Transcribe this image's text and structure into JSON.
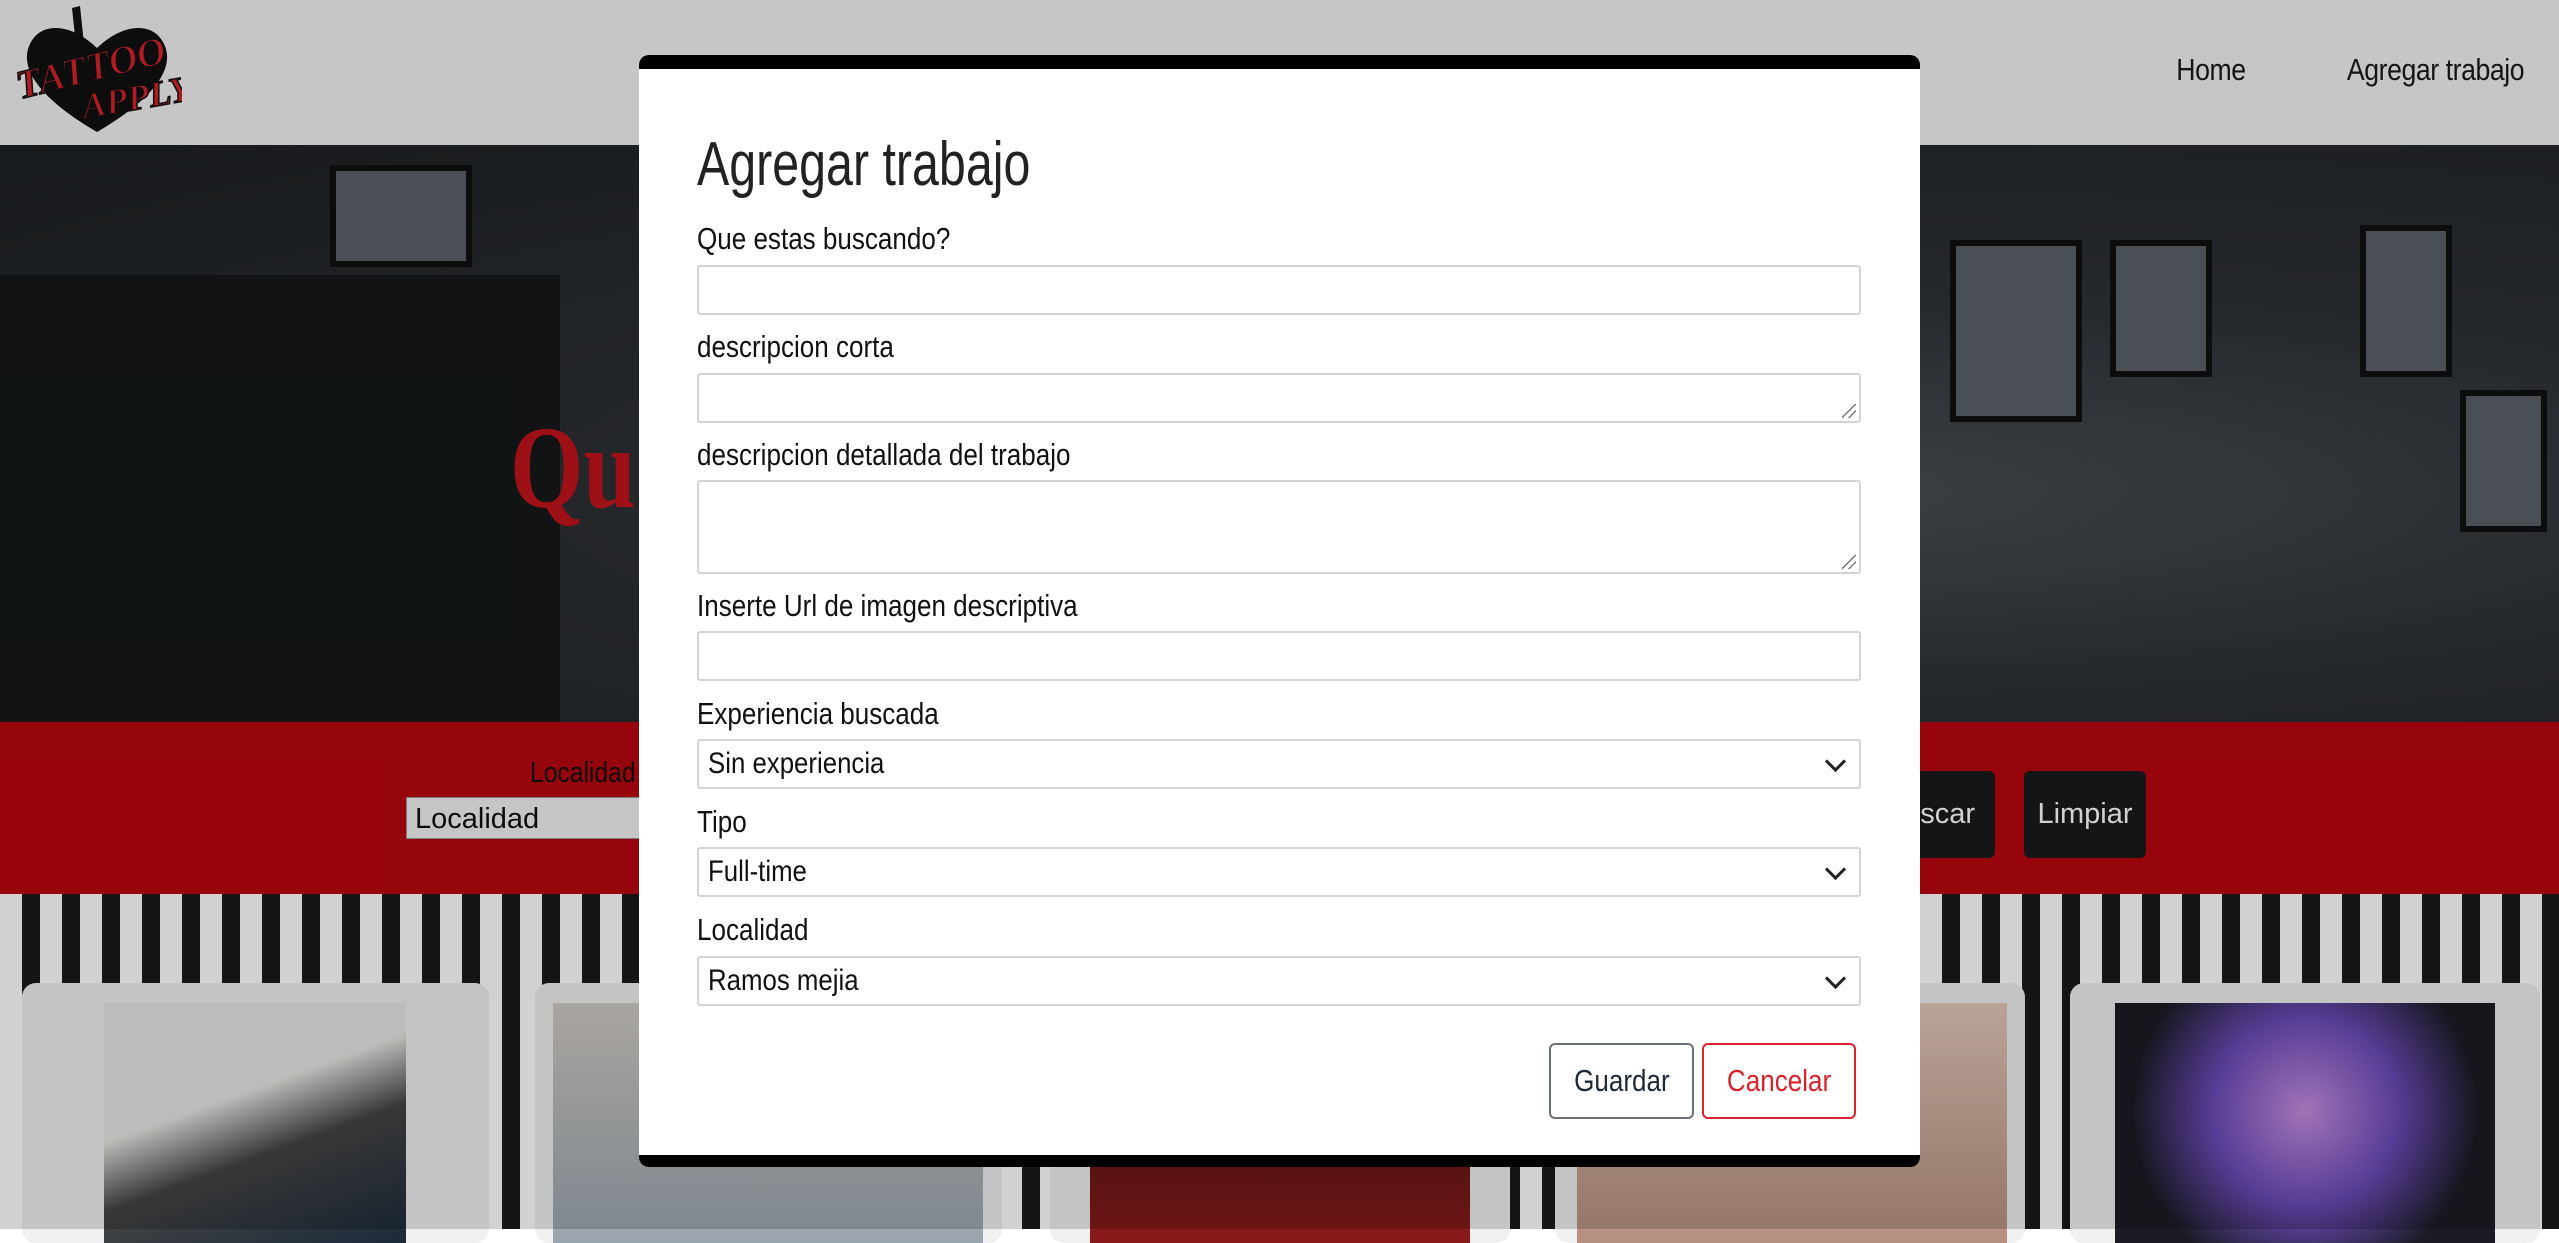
{
  "nav": {
    "logo_text": "TATTOO APPLY",
    "links": [
      "Home",
      "Agregar trabajo"
    ]
  },
  "hero": {
    "title_visible": "Que... je?"
  },
  "filters": {
    "localidad_label": "Localidad",
    "localidad_value": "Localidad",
    "search_button": "uscar",
    "clear_button": "Limpiar"
  },
  "modal": {
    "title": "Agregar trabajo",
    "fields": {
      "what_label": "Que estas buscando?",
      "what_value": "",
      "short_desc_label": "descripcion corta",
      "short_desc_value": "",
      "long_desc_label": "descripcion detallada del trabajo",
      "long_desc_value": "",
      "image_url_label": "Inserte Url de imagen descriptiva",
      "image_url_value": "",
      "experience_label": "Experiencia buscada",
      "experience_value": "Sin experiencia",
      "type_label": "Tipo",
      "type_value": "Full-time",
      "location_label": "Localidad",
      "location_value": "Ramos mejia"
    },
    "save_button": "Guardar",
    "cancel_button": "Cancelar"
  },
  "colors": {
    "brand_red": "#b8050f",
    "cancel_red": "#d9232d",
    "modal_border": "#000000"
  }
}
